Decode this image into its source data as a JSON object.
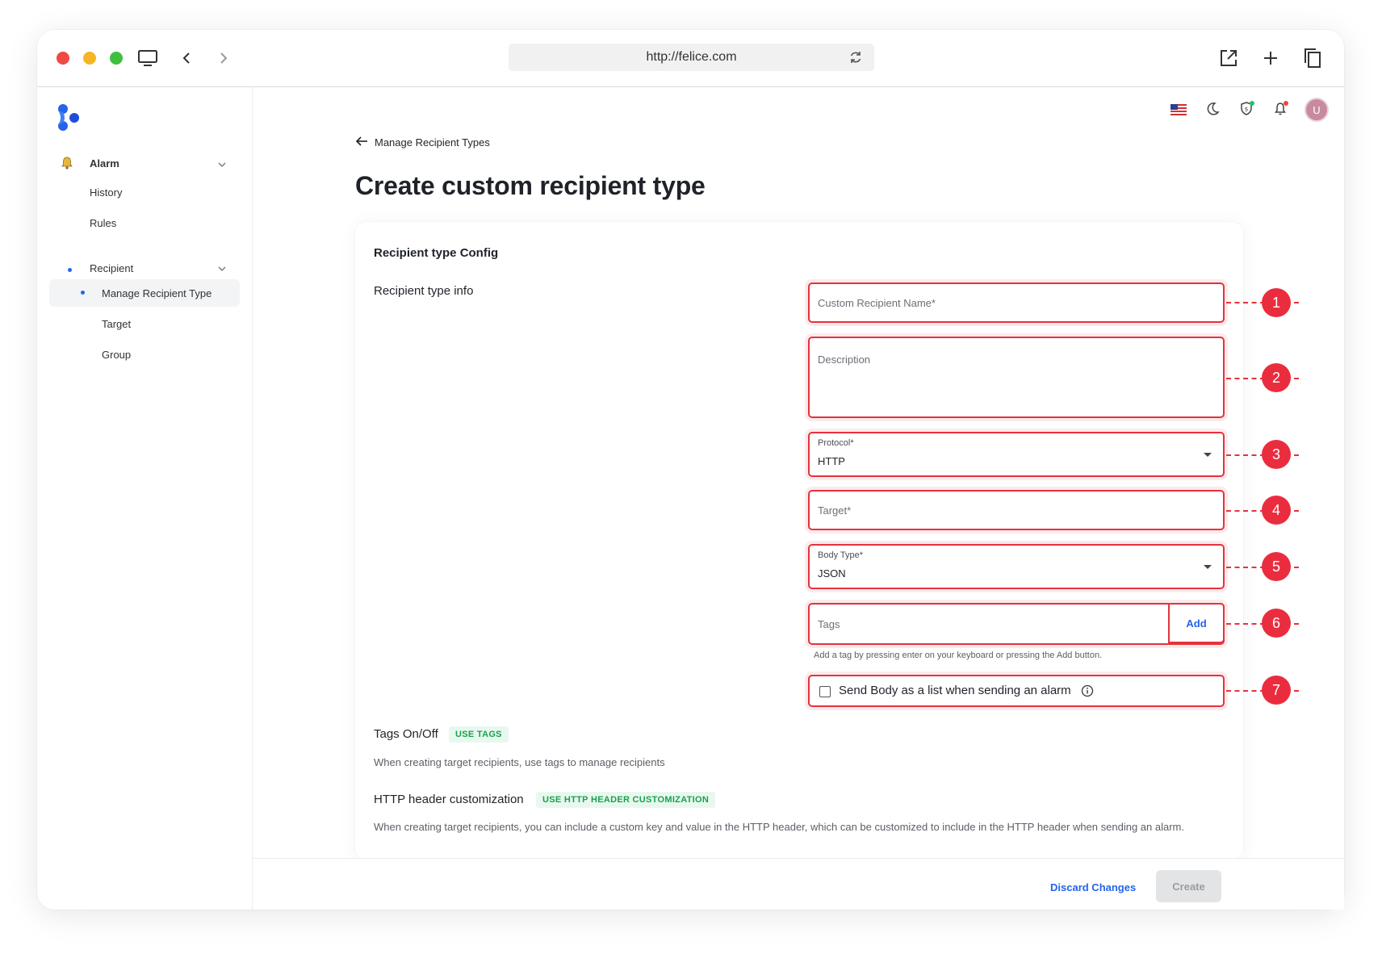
{
  "browser": {
    "url": "http://felice.com"
  },
  "sidebar": {
    "items": [
      {
        "label": "Alarm"
      },
      {
        "label": "History"
      },
      {
        "label": "Rules"
      },
      {
        "label": "Recipient"
      },
      {
        "label": "Manage Recipient Type"
      },
      {
        "label": "Target"
      },
      {
        "label": "Group"
      }
    ]
  },
  "header": {
    "avatar_initial": "U"
  },
  "page": {
    "back_label": "Manage Recipient Types",
    "title": "Create custom recipient type"
  },
  "form": {
    "card_title": "Recipient type Config",
    "section_label": "Recipient type info",
    "name_placeholder": "Custom Recipient Name*",
    "description_placeholder": "Description",
    "protocol_label": "Protocol*",
    "protocol_value": "HTTP",
    "target_placeholder": "Target*",
    "body_type_label": "Body Type*",
    "body_type_value": "JSON",
    "tags_placeholder": "Tags",
    "add_label": "Add",
    "tags_help": "Add a tag by pressing enter on your keyboard or pressing the Add button.",
    "send_list_label": "Send Body as a list when sending an alarm"
  },
  "callouts": [
    "1",
    "2",
    "3",
    "4",
    "5",
    "6",
    "7"
  ],
  "tags_section": {
    "title": "Tags On/Off",
    "badge": "USE TAGS",
    "description": "When creating target recipients, use tags to manage recipients"
  },
  "http_section": {
    "title": "HTTP header customization",
    "badge": "USE HTTP HEADER CUSTOMIZATION",
    "description": "When creating target recipients, you can include a custom key and value in the HTTP header, which can be customized to include in the HTTP header when sending an alarm."
  },
  "footer": {
    "discard_label": "Discard Changes",
    "create_label": "Create"
  },
  "colors": {
    "accent": "#2563eb",
    "annotation": "#e5323f",
    "badge_green": "#16a34a"
  },
  "icons": [
    "monitor-icon",
    "back-arrow-icon",
    "forward-arrow-icon",
    "reload-icon",
    "external-link-icon",
    "plus-icon",
    "copy-icon",
    "bell-icon",
    "chevron-down-icon",
    "us-flag-icon",
    "moon-icon",
    "shield-icon",
    "notification-bell-icon",
    "info-icon",
    "arrow-left-icon"
  ]
}
